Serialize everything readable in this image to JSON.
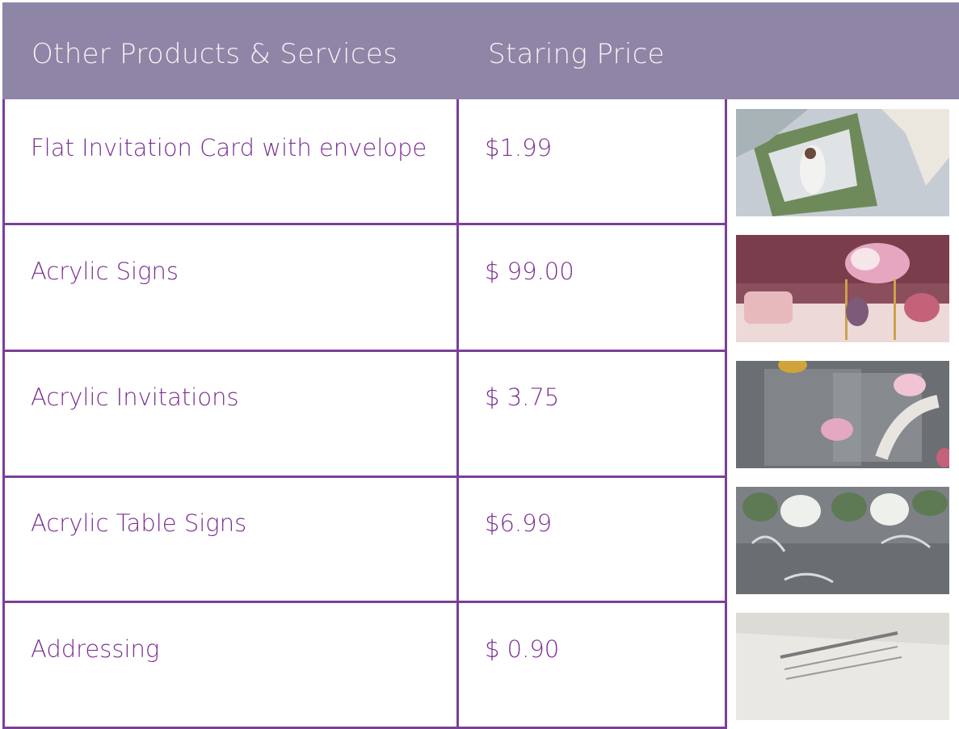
{
  "header": {
    "col1": "Other Products & Services",
    "col2": "Staring Price"
  },
  "rows": [
    {
      "name": "Flat Invitation Card with envelope",
      "price": "$1.99",
      "image": "wedding-couple-photo-card"
    },
    {
      "name": "Acrylic Signs",
      "price": "$ 99.00",
      "image": "acrylic-sign-floral-display"
    },
    {
      "name": "Acrylic Invitations",
      "price": "$ 3.75",
      "image": "acrylic-invitation-floral"
    },
    {
      "name": "Acrylic Table Signs",
      "price": "$6.99",
      "image": "acrylic-table-sign-floral"
    },
    {
      "name": "Addressing",
      "price": "$ 0.90",
      "image": "addressed-envelope"
    }
  ],
  "colors": {
    "header_bg": "#8f85a7",
    "header_text": "#fbeef3",
    "border": "#7b3f98",
    "cell_text": "#7b2f92"
  }
}
